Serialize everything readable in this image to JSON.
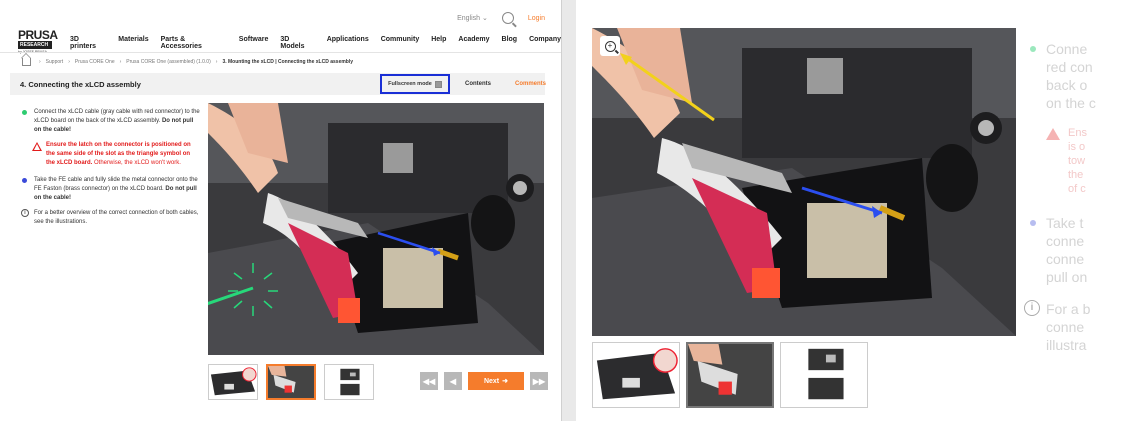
{
  "header": {
    "language": "English",
    "login": "Login",
    "logo": {
      "line1": "PRUSA",
      "line2": "RESEARCH",
      "line3": "by JOSEF PRUSA"
    },
    "nav": [
      "3D printers",
      "Materials",
      "Parts & Accessories",
      "Software",
      "3D Models",
      "Applications",
      "Community",
      "Help",
      "Academy",
      "Blog",
      "Company"
    ]
  },
  "breadcrumb": [
    "Support",
    "Prusa CORE One",
    "Prusa CORE One (assembled) (1.0.0)",
    "3. Mounting the xLCD | Connecting the xLCD assembly"
  ],
  "step": {
    "title": "4. Connecting the xLCD assembly",
    "fullscreen_label": "Fullscreen mode",
    "contents_label": "Contents",
    "comments_label": "Comments"
  },
  "instructions": {
    "b1_text": "Connect the xLCD cable (gray cable with red connector) to the xLCD board on the back of the xLCD assembly.",
    "b1_bold": "Do not pull on the cable!",
    "warn_bold": "Ensure the latch on the connector is positioned on the same side of the slot as the triangle symbol on the xLCD board.",
    "warn_text": "Otherwise, the xLCD won't work.",
    "b2_text": "Take the FE cable and fully slide the metal connector onto the FE Faston (brass connector) on the xLCD board.",
    "b2_bold": "Do not pull on the cable!",
    "info_text": "For a better overview of the correct connection of both cables, see the illustrations."
  },
  "pager": {
    "first": "◀◀",
    "prev": "◀",
    "next_label": "Next",
    "next_arrow": "➜",
    "last": "▶▶"
  },
  "right_faded": {
    "line1": "Conne",
    "line2": "red con",
    "line3": "back o",
    "line4": "on the c",
    "warn1": "Ens",
    "warn2": "is o",
    "warn3": "tow",
    "warn4": "the",
    "warn5": "of c",
    "b2_1": "Take t",
    "b2_2": "conne",
    "b2_3": "conne",
    "b2_4": "pull on",
    "i1": "For a b",
    "i2": "conne",
    "i3": "illustra"
  },
  "colors": {
    "accent": "#f57c2c",
    "green": "#2ecc71",
    "blue": "#3b4ad9",
    "warn": "#e21b1b",
    "highlight": "#1a2fd6"
  }
}
